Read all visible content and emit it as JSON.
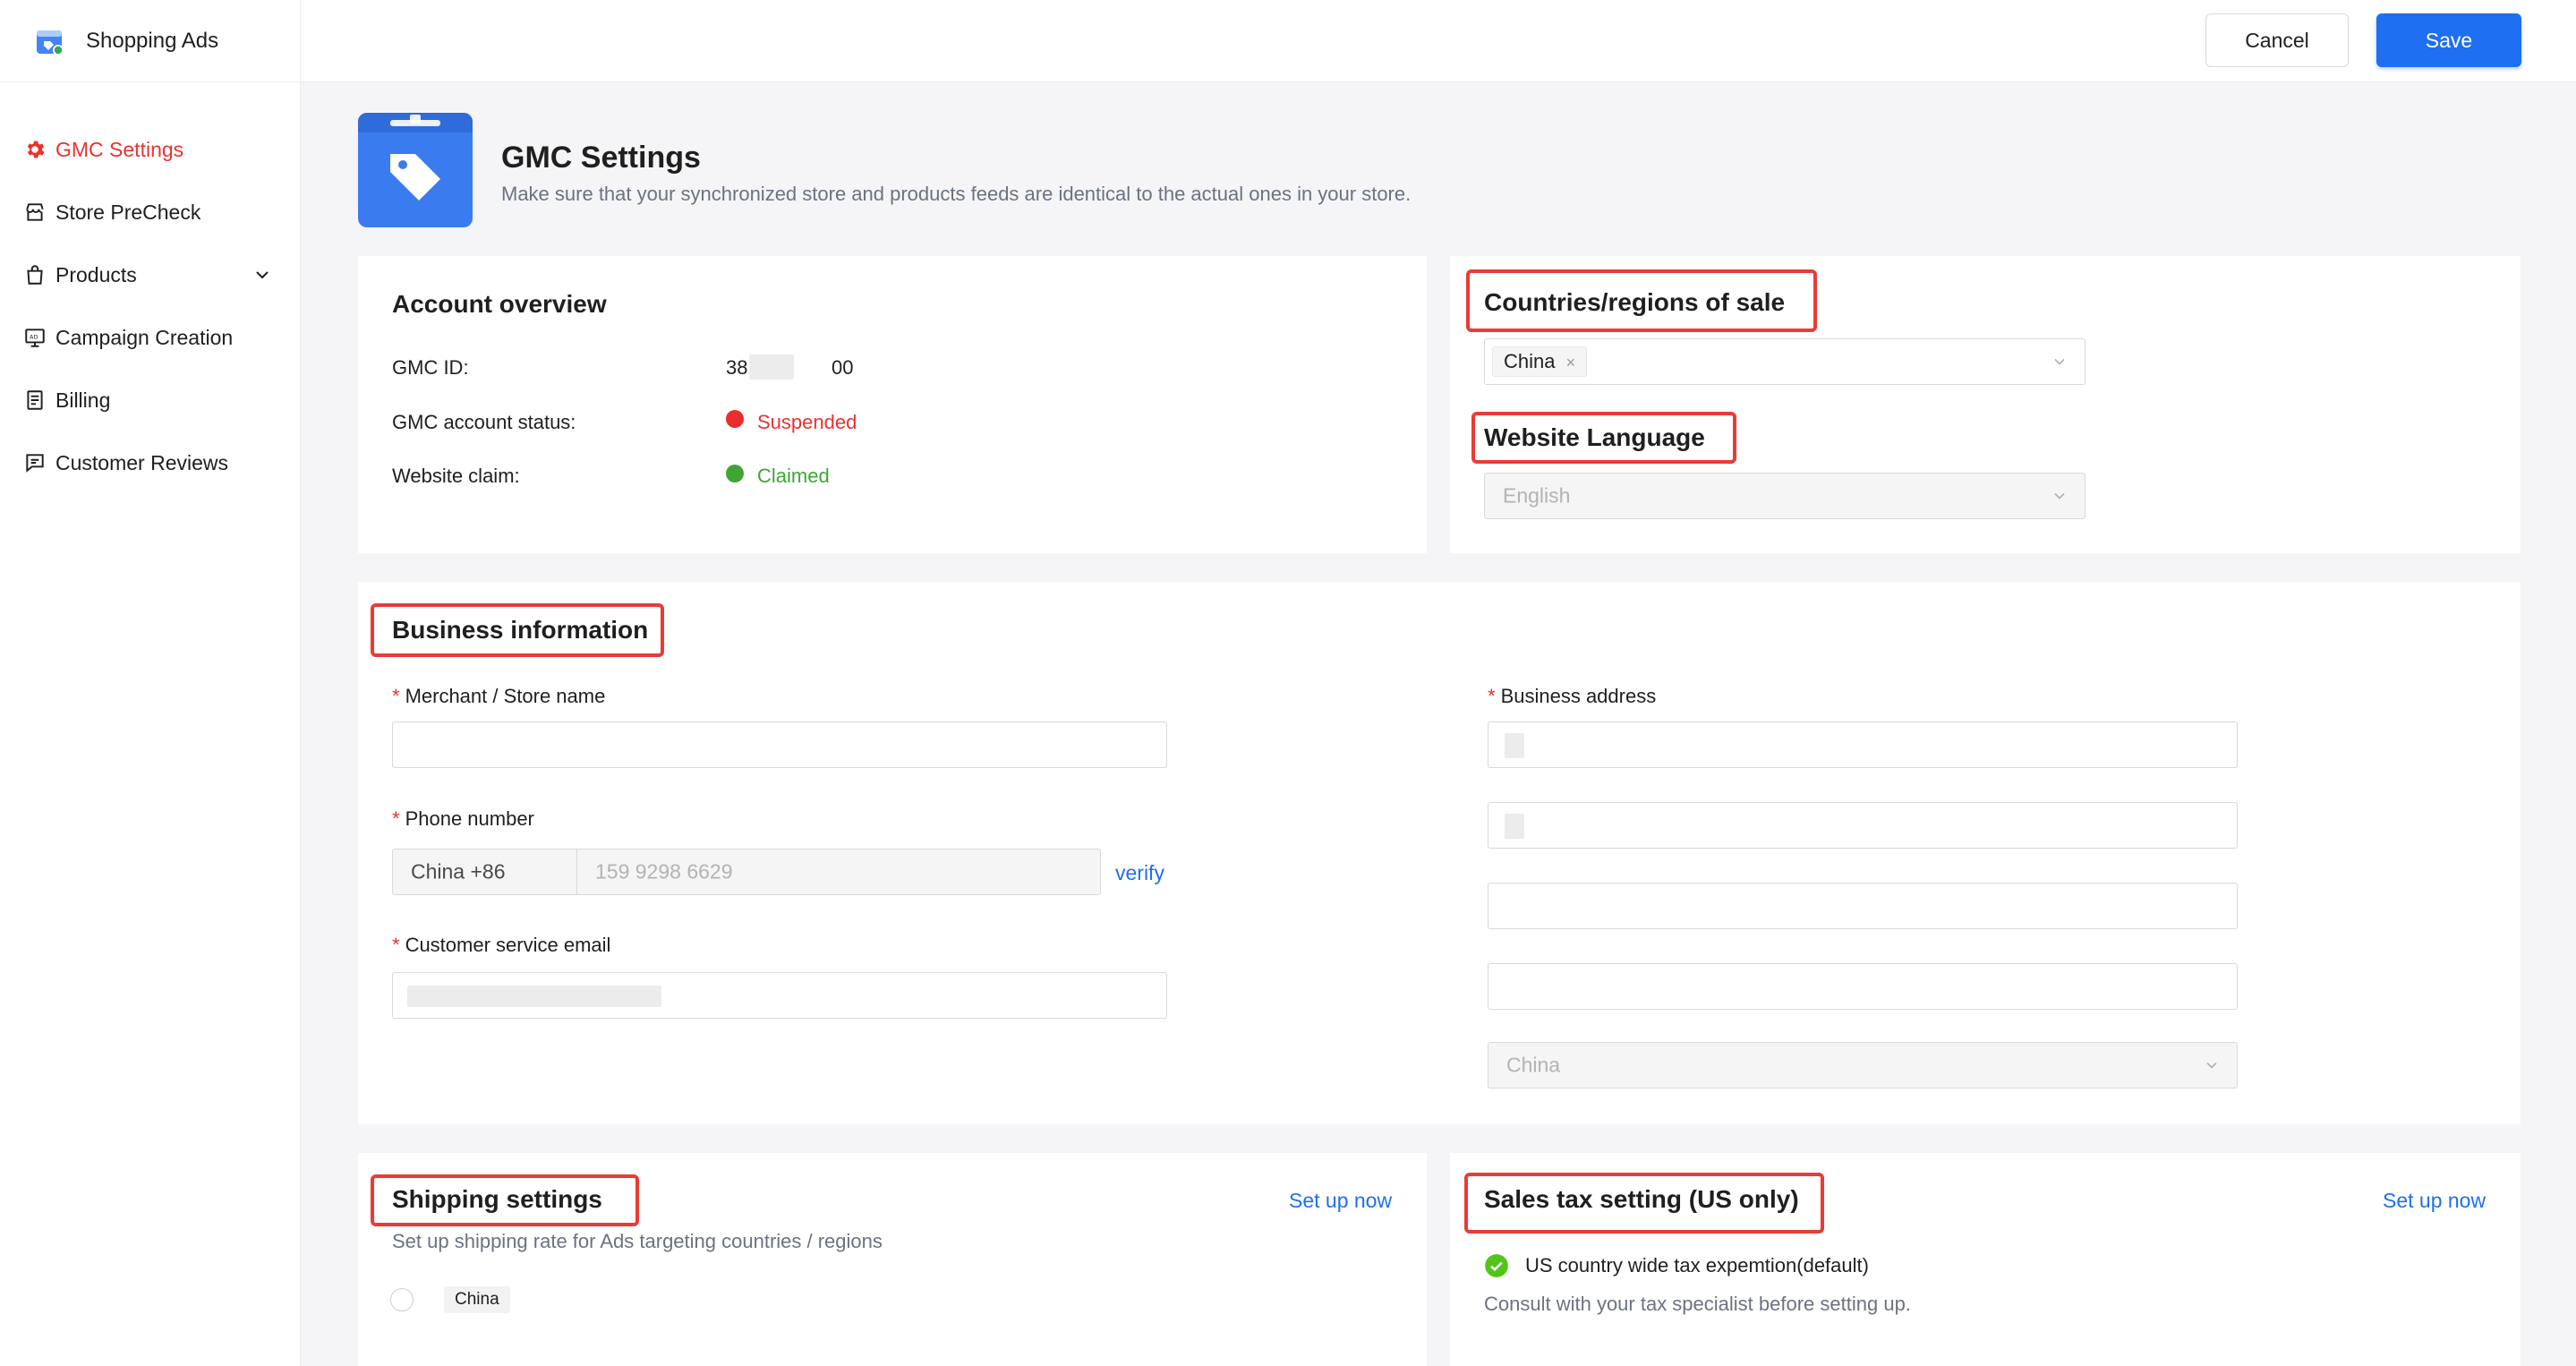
{
  "app": {
    "name": "Shopping Ads"
  },
  "sidebar": {
    "items": [
      {
        "label": "GMC Settings",
        "icon": "gear-icon",
        "active": true
      },
      {
        "label": "Store PreCheck",
        "icon": "store-icon"
      },
      {
        "label": "Products",
        "icon": "shopping-bag-icon",
        "expandable": true
      },
      {
        "label": "Campaign Creation",
        "icon": "ad-icon"
      },
      {
        "label": "Billing",
        "icon": "document-icon"
      },
      {
        "label": "Customer Reviews",
        "icon": "review-icon"
      }
    ]
  },
  "toolbar": {
    "cancel_label": "Cancel",
    "save_label": "Save"
  },
  "header": {
    "title": "GMC Settings",
    "subtitle": "Make sure that your synchronized store and products feeds are identical to the actual ones in your store."
  },
  "account": {
    "title": "Account overview",
    "gmc_id_label": "GMC ID:",
    "gmc_id_prefix": "38",
    "gmc_id_suffix": "00",
    "status_label": "GMC account status:",
    "status_value": "Suspended",
    "claim_label": "Website claim:",
    "claim_value": "Claimed"
  },
  "regions": {
    "countries_title": "Countries/regions of sale",
    "selected_country": "China",
    "language_title": "Website Language",
    "language_value": "English"
  },
  "business": {
    "title": "Business information",
    "store_name_label": "Merchant / Store name",
    "store_name_value": "",
    "phone_label": "Phone number",
    "phone_country": "China +86",
    "phone_number": "159 9298 6629",
    "verify_label": "verify",
    "email_label": "Customer service email",
    "address_label": "Business address",
    "address_country": "China"
  },
  "shipping": {
    "title": "Shipping settings",
    "setup_label": "Set up now",
    "description": "Set up shipping rate for Ads targeting countries / regions",
    "country_tag": "China"
  },
  "sales_tax": {
    "title": "Sales tax setting (US only)",
    "setup_label": "Set up now",
    "option_label": "US country wide tax expemtion(default)",
    "note": "Consult with your tax specialist before setting up."
  },
  "colors": {
    "accent": "#1e6ff1",
    "active_nav": "#e8332f",
    "suspended": "#e8332f",
    "claimed": "#3fa535",
    "highlight": "#ea3b36"
  }
}
